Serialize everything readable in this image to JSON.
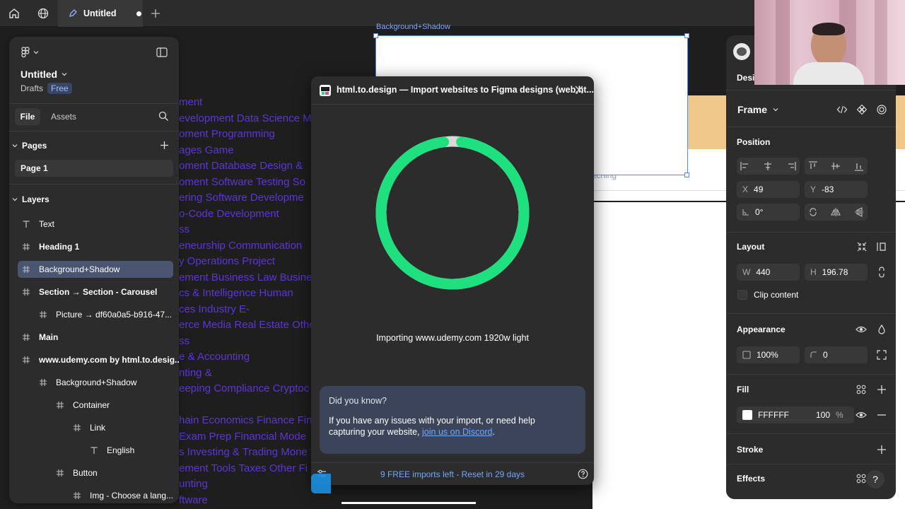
{
  "tabs": {
    "active_title": "Untitled"
  },
  "canvas": {
    "frame_label": "Background+Shadow",
    "page_partial_text": "tching",
    "purple_lines": [
      "ment",
      "evelopment Data Science M",
      "oment Programming",
      "ages Game",
      "oment Database Design &",
      "oment Software Testing So",
      "ering Software Developme",
      "o-Code Development",
      "ss",
      "eneurship Communication",
      "y Operations Project",
      "ement Business Law Busine",
      "cs & Intelligence Human",
      "ces Industry E-",
      "erce Media Real Estate Othe",
      "ss",
      "e & Accounting",
      "nting &",
      "eeping Compliance Cryptoc",
      "",
      "hain Economics Finance Fin",
      "Exam Prep Financial Mode",
      "s Investing & Trading Mone",
      "ement Tools Taxes Other Fi",
      "unting",
      "ftware"
    ]
  },
  "left_panel": {
    "file_title": "Untitled",
    "drafts_label": "Drafts",
    "plan_badge": "Free",
    "tab_file": "File",
    "tab_assets": "Assets",
    "pages_heading": "Pages",
    "page_item": "Page 1",
    "layers_heading": "Layers",
    "layers": [
      {
        "label": "Text",
        "indent": 0,
        "bold": false,
        "icon": "text"
      },
      {
        "label": "Heading 1",
        "indent": 0,
        "bold": true,
        "icon": "hash"
      },
      {
        "label": "Background+Shadow",
        "indent": 0,
        "bold": false,
        "icon": "hash",
        "selected": true
      },
      {
        "label": "Section → Section - Carousel",
        "indent": 0,
        "bold": true,
        "icon": "hash"
      },
      {
        "label": "Picture → df60a0a5-b916-47...",
        "indent": 1,
        "bold": false,
        "icon": "hash"
      },
      {
        "label": "Main",
        "indent": 0,
        "bold": true,
        "icon": "hash"
      },
      {
        "label": "www.udemy.com by html.to.desig...",
        "indent": 0,
        "bold": true,
        "icon": "hash"
      },
      {
        "label": "Background+Shadow",
        "indent": 1,
        "bold": false,
        "icon": "hash"
      },
      {
        "label": "Container",
        "indent": 2,
        "bold": false,
        "icon": "hash"
      },
      {
        "label": "Link",
        "indent": 3,
        "bold": false,
        "icon": "hash"
      },
      {
        "label": "English",
        "indent": 4,
        "bold": false,
        "icon": "text"
      },
      {
        "label": "Button",
        "indent": 2,
        "bold": false,
        "icon": "hash"
      },
      {
        "label": "Img - Choose a lang...",
        "indent": 3,
        "bold": false,
        "icon": "hash"
      }
    ]
  },
  "plugin": {
    "title": "html.to.design — Import websites to Figma designs (web,ht...",
    "progress_fraction": 0.96,
    "status": "Importing www.udemy.com 1920w light",
    "tip_heading": "Did you know?",
    "tip_body": "If you have any issues with your import, or need help capturing your website,",
    "tip_link": "join us on Discord",
    "tip_end": ".",
    "footer_text": "9 FREE imports left - Reset in 29 days"
  },
  "right_panel": {
    "design_tab": "Desi",
    "frame_label": "Frame",
    "position_heading": "Position",
    "x_key": "X",
    "x_value": "49",
    "y_key": "Y",
    "y_value": "-83",
    "rotation_value": "0°",
    "layout_heading": "Layout",
    "w_key": "W",
    "w_value": "440",
    "h_key": "H",
    "h_value": "196.78",
    "clip_content": "Clip content",
    "appearance_heading": "Appearance",
    "opacity_value": "100%",
    "radius_value": "0",
    "fill_heading": "Fill",
    "fill_hex": "FFFFFF",
    "fill_opacity": "100",
    "fill_percent": "%",
    "stroke_heading": "Stroke",
    "effects_heading": "Effects",
    "help_label": "?"
  },
  "colors": {
    "accent_green": "#1fe07f",
    "selection_blue": "#4c8dff",
    "link_purple": "#5d35d6"
  }
}
